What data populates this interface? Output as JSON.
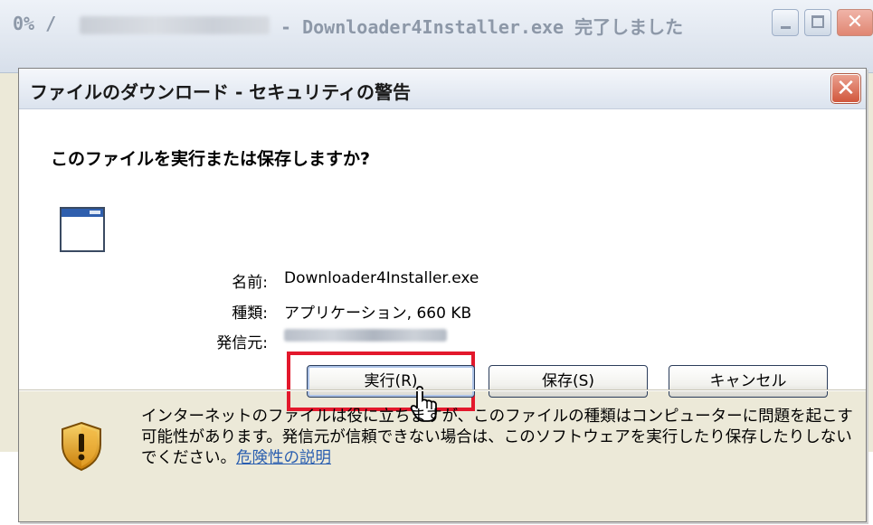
{
  "background_window": {
    "title_progress": "0% /",
    "title_suffix": "- Downloader4Installer.exe 完了しました"
  },
  "dialog": {
    "title": "ファイルのダウンロード - セキュリティの警告",
    "close_glyph": "✕",
    "question": "このファイルを実行または保存しますか?",
    "fields": {
      "name_label": "名前:",
      "name_value": "Downloader4Installer.exe",
      "type_label": "種類:",
      "type_value": "アプリケーション, 660 KB",
      "publisher_label": "発信元:"
    },
    "buttons": {
      "run": "実行(R)",
      "save": "保存(S)",
      "cancel": "キャンセル"
    },
    "warning": {
      "text": "インターネットのファイルは役に立ちますが、このファイルの種類はコンピューターに問題を起こす可能性があります。発信元が信頼できない場合は、このソフトウェアを実行したり保存したりしないでください。",
      "link": "危険性の説明"
    }
  },
  "colors": {
    "highlight": "#e3182c",
    "link": "#2b5fb0",
    "shield_gold": "#e0a21a"
  },
  "icons": [
    "minimize-icon",
    "maximize-icon",
    "close-icon",
    "application-window-icon",
    "hand-cursor-icon",
    "shield-warning-icon"
  ]
}
